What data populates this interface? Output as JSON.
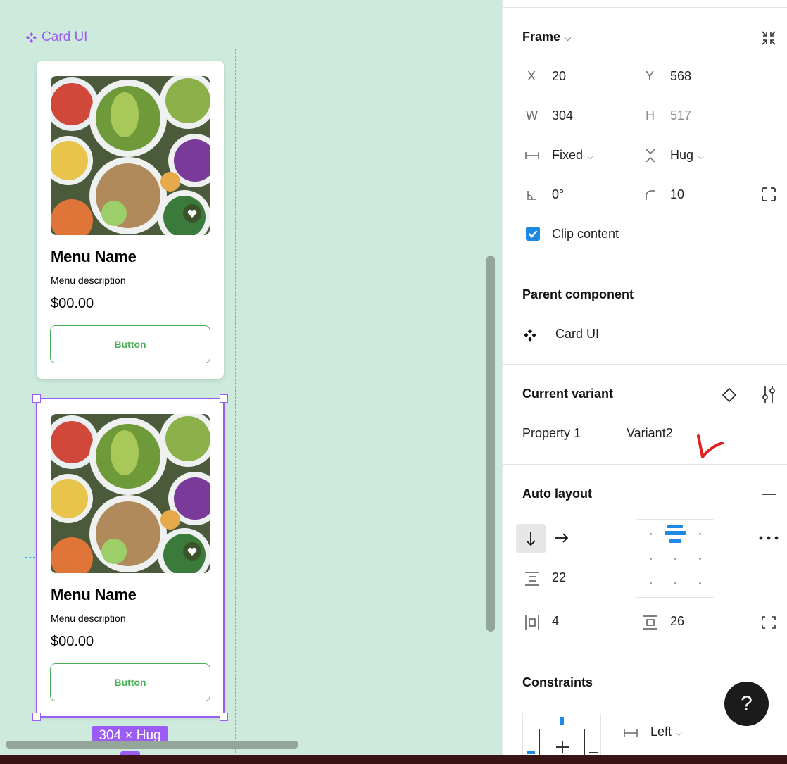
{
  "canvas": {
    "component_label": "Card UI",
    "size_badge": "304 × Hug",
    "cards": [
      {
        "title": "Menu Name",
        "description": "Menu description",
        "price": "$00.00",
        "button": "Button"
      },
      {
        "title": "Menu Name",
        "description": "Menu description",
        "price": "$00.00",
        "button": "Button"
      }
    ]
  },
  "panel": {
    "frame": {
      "title": "Frame",
      "x_label": "X",
      "x_value": "20",
      "y_label": "Y",
      "y_value": "568",
      "w_label": "W",
      "w_value": "304",
      "h_label": "H",
      "h_value": "517",
      "width_mode": "Fixed",
      "height_mode": "Hug",
      "rotation": "0°",
      "radius": "10",
      "clip_label": "Clip content",
      "clip_checked": true
    },
    "parent_component": {
      "title": "Parent component",
      "name": "Card UI"
    },
    "current_variant": {
      "title": "Current variant",
      "property": "Property 1",
      "value": "Variant2"
    },
    "auto_layout": {
      "title": "Auto layout",
      "gap": "22",
      "padding_h": "4",
      "padding_v": "26"
    },
    "constraints": {
      "title": "Constraints",
      "horizontal": "Left"
    },
    "help": "?"
  },
  "colors": {
    "canvas": "#cdeadc",
    "selection": "#9b5cf6",
    "button_green": "#4cb05a",
    "accent_blue": "#1e88e5"
  }
}
